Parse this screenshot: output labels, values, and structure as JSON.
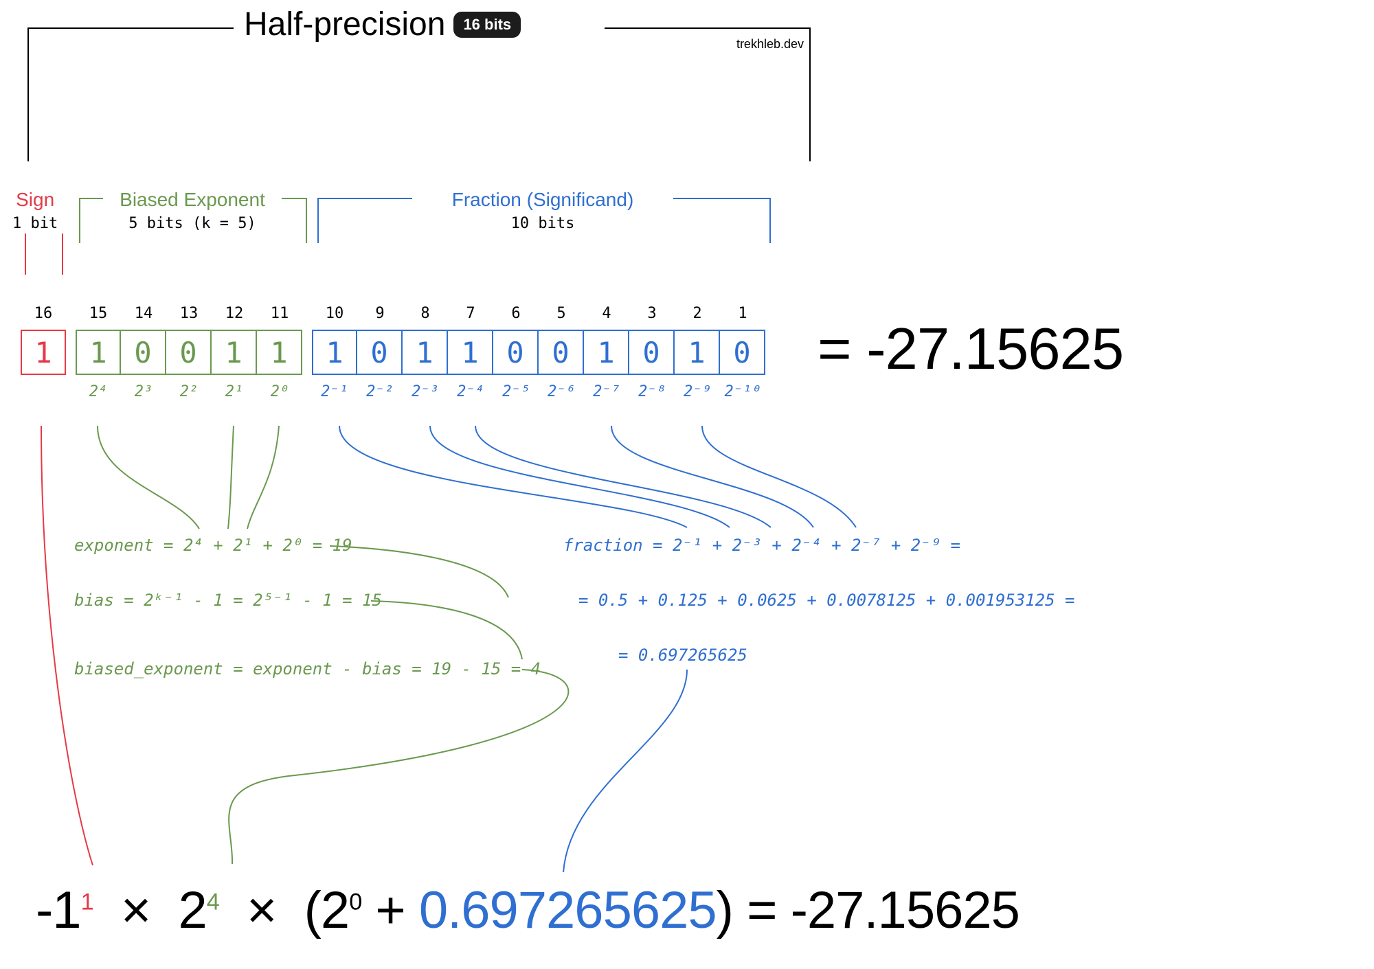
{
  "title": {
    "text": "Half-precision",
    "badge": "16 bits"
  },
  "source": "trekhleb.dev",
  "sections": {
    "sign": {
      "label": "Sign",
      "sub": "1 bit"
    },
    "exp": {
      "label": "Biased Exponent",
      "sub": "5 bits (k = 5)"
    },
    "frac": {
      "label": "Fraction (Significand)",
      "sub": "10 bits"
    }
  },
  "bit_indices": [
    "16",
    "15",
    "14",
    "13",
    "12",
    "11",
    "10",
    "9",
    "8",
    "7",
    "6",
    "5",
    "4",
    "3",
    "2",
    "1"
  ],
  "bits": {
    "sign": [
      "1"
    ],
    "exp": [
      "1",
      "0",
      "0",
      "1",
      "1"
    ],
    "frac": [
      "1",
      "0",
      "1",
      "1",
      "0",
      "0",
      "1",
      "0",
      "1",
      "0"
    ]
  },
  "powers_exp": [
    "2⁴",
    "2³",
    "2²",
    "2¹",
    "2⁰"
  ],
  "powers_frac": [
    "2⁻¹",
    "2⁻²",
    "2⁻³",
    "2⁻⁴",
    "2⁻⁵",
    "2⁻⁶",
    "2⁻⁷",
    "2⁻⁸",
    "2⁻⁹",
    "2⁻¹⁰"
  ],
  "result_label": "= -27.15625",
  "calc": {
    "exp_line": "exponent = 2⁴ + 2¹ + 2⁰ = 19",
    "bias_line": "bias = 2ᵏ⁻¹ - 1 = 2⁵⁻¹ - 1 = 15",
    "biased_line": "biased_exponent = exponent - bias = 19 - 15 = 4",
    "frac_l1": "fraction = 2⁻¹ + 2⁻³ + 2⁻⁴ + 2⁻⁷ + 2⁻⁹ =",
    "frac_l2": "= 0.5 + 0.125 + 0.0625 + 0.0078125 + 0.001953125 =",
    "frac_l3": "= 0.697265625"
  },
  "formula": {
    "neg1": "-1",
    "sign_sup": "1",
    "mult": "×",
    "base2": "2",
    "exp_sup": "4",
    "open": "(2",
    "zero_sup": "0",
    "plus": "+",
    "fraction": "0.697265625",
    "close": ")",
    "eq": "=",
    "result": "-27.15625"
  }
}
